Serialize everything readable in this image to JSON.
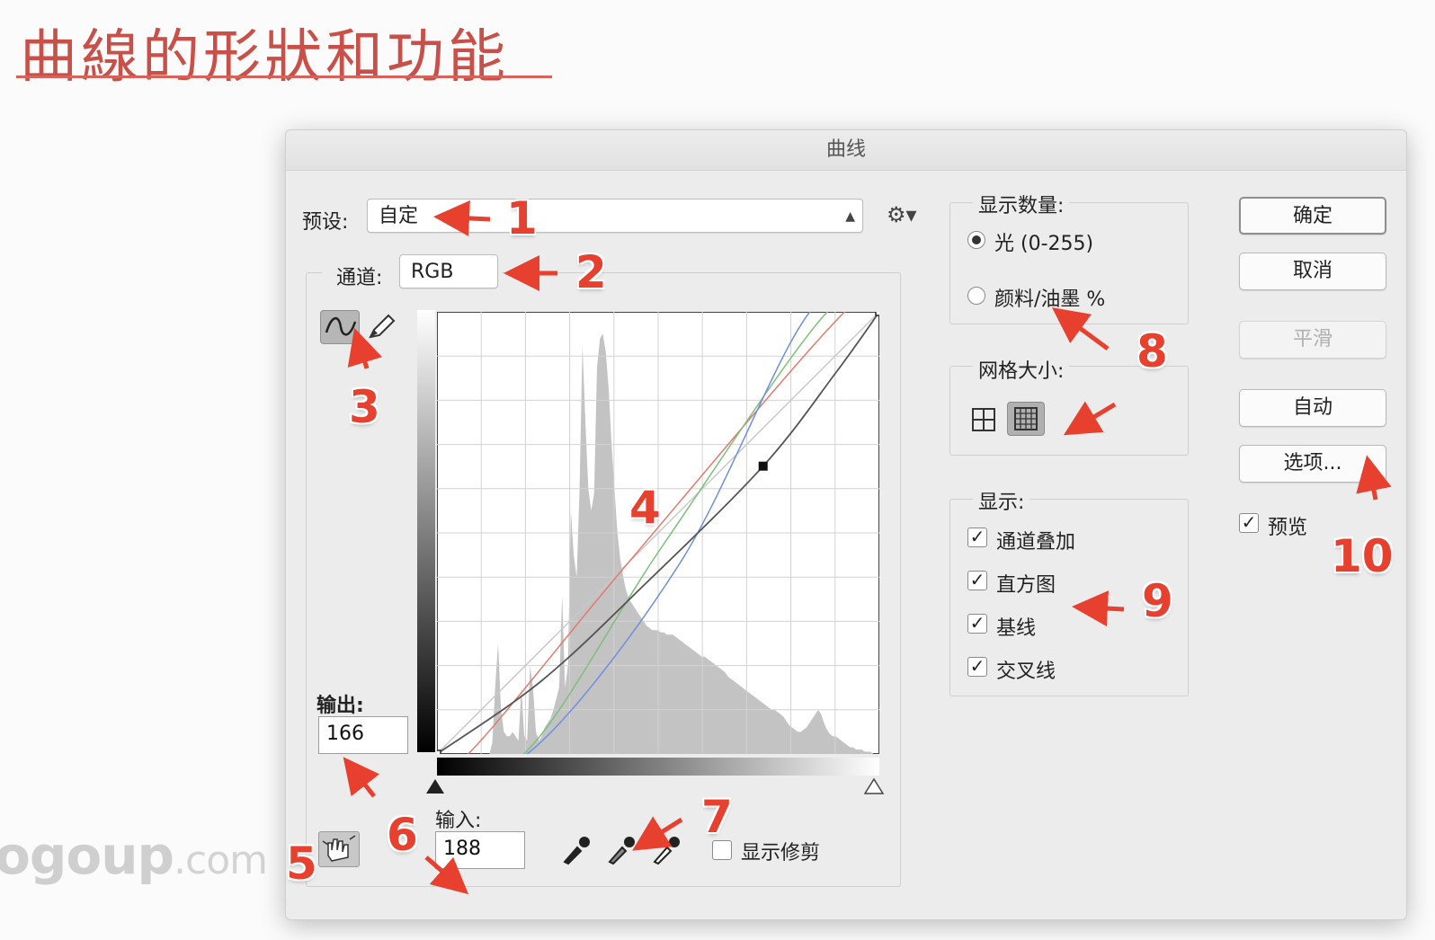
{
  "slide": {
    "title": "曲線的形狀和功能",
    "watermark_main": "ogoup",
    "watermark_suffix": ".com"
  },
  "dialog": {
    "title": "曲线",
    "preset": {
      "label": "预设:",
      "value": "自定"
    },
    "channel": {
      "label": "通道:",
      "value": "RGB"
    },
    "output": {
      "label": "输出:",
      "value": "166"
    },
    "input": {
      "label": "输入:",
      "value": "188"
    },
    "show_clipping": {
      "label": "显示修剪",
      "checked": false
    },
    "show_amount": {
      "title": "显示数量:",
      "options": [
        {
          "label": "光 (0-255)",
          "selected": true
        },
        {
          "label": "颜料/油墨 %",
          "selected": false
        }
      ]
    },
    "grid_size": {
      "title": "网格大小:",
      "selected": "fine"
    },
    "show": {
      "title": "显示:",
      "items": [
        {
          "label": "通道叠加",
          "checked": true
        },
        {
          "label": "直方图",
          "checked": true
        },
        {
          "label": "基线",
          "checked": true
        },
        {
          "label": "交叉线",
          "checked": true
        }
      ]
    },
    "buttons": {
      "ok": "确定",
      "cancel": "取消",
      "smooth": "平滑",
      "auto": "自动",
      "options": "选项..."
    },
    "preview": {
      "label": "预览",
      "checked": true
    },
    "check_mark": "✓"
  },
  "curve": {
    "scale": [
      0,
      255
    ],
    "point": {
      "input": 188,
      "output": 166
    },
    "composite_curve": [
      [
        0,
        0
      ],
      [
        60,
        42
      ],
      [
        120,
        98
      ],
      [
        188,
        166
      ],
      [
        230,
        220
      ],
      [
        255,
        255
      ]
    ],
    "red_curve": [
      [
        0,
        0
      ],
      [
        18,
        0
      ],
      [
        110,
        110
      ],
      [
        235,
        255
      ],
      [
        255,
        255
      ]
    ],
    "green_curve": [
      [
        0,
        0
      ],
      [
        50,
        0
      ],
      [
        130,
        120
      ],
      [
        225,
        255
      ],
      [
        255,
        255
      ]
    ],
    "blue_curve": [
      [
        0,
        0
      ],
      [
        52,
        0
      ],
      [
        140,
        110
      ],
      [
        215,
        255
      ],
      [
        255,
        255
      ]
    ],
    "histogram": [
      0,
      0,
      0,
      0,
      0,
      0,
      0,
      0,
      0,
      0,
      0,
      0,
      0,
      0,
      0,
      0,
      0,
      0,
      0,
      5,
      30,
      50,
      20,
      10,
      8,
      8,
      10,
      8,
      6,
      30,
      8,
      6,
      40,
      30,
      10,
      6,
      8,
      12,
      14,
      16,
      20,
      25,
      30,
      72,
      30,
      40,
      110,
      90,
      80,
      120,
      185,
      150,
      120,
      110,
      118,
      175,
      188,
      190,
      182,
      165,
      140,
      120,
      100,
      88,
      80,
      74,
      70,
      68,
      66,
      64,
      62,
      60,
      58,
      57,
      56,
      56,
      56,
      55,
      55,
      54,
      54,
      54,
      53,
      52,
      51,
      50,
      49,
      48,
      47,
      46,
      45,
      44,
      44,
      43,
      42,
      41,
      40,
      39,
      38,
      37,
      35,
      34,
      33,
      32,
      31,
      30,
      29,
      28,
      27,
      26,
      25,
      24,
      23,
      22,
      21,
      20,
      20,
      19,
      18,
      17,
      15,
      13,
      12,
      11,
      10,
      10,
      11,
      12,
      14,
      16,
      18,
      20,
      18,
      14,
      11,
      9,
      8,
      8,
      7,
      6,
      5,
      4,
      3,
      3,
      2,
      2,
      2,
      1,
      1,
      1,
      0,
      0,
      0
    ],
    "colors": {
      "red": "#e07a6e",
      "green": "#7cc07a",
      "blue": "#6f8fe0",
      "composite": "#555555",
      "baseline": "#c8c8c8",
      "histogram": "#c3c3c3"
    }
  },
  "annotations": {
    "labels": [
      "1",
      "2",
      "3",
      "4",
      "5",
      "6",
      "7",
      "8",
      "9",
      "10"
    ],
    "color": "#e8402f"
  }
}
